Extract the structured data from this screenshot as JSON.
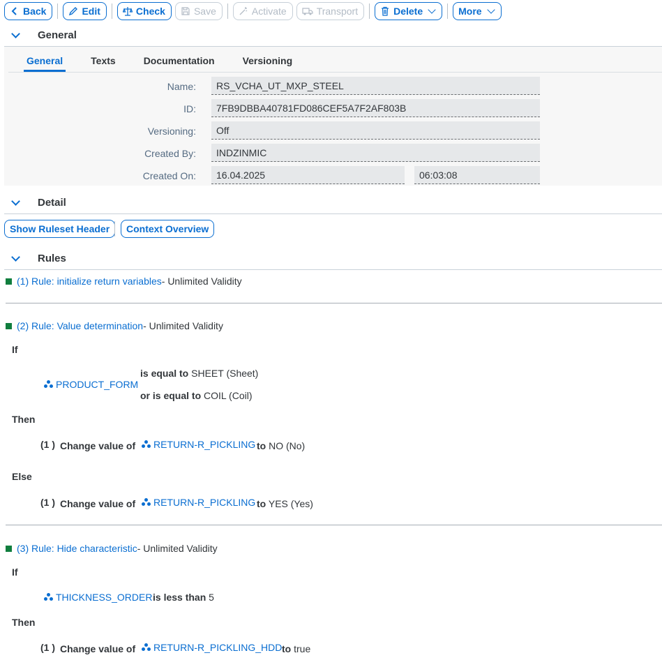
{
  "toolbar": {
    "back": "Back",
    "edit": "Edit",
    "check": "Check",
    "save": "Save",
    "activate": "Activate",
    "transport": "Transport",
    "delete": "Delete",
    "more": "More"
  },
  "general": {
    "section_title": "General",
    "tabs": [
      "General",
      "Texts",
      "Documentation",
      "Versioning"
    ],
    "fields": {
      "name_label": "Name:",
      "name_value": "RS_VCHA_UT_MXP_STEEL",
      "id_label": "ID:",
      "id_value": "7FB9DBBA40781FD086CEF5A7F2AF803B",
      "versioning_label": "Versioning:",
      "versioning_value": "Off",
      "created_by_label": "Created By:",
      "created_by_value": "INDZINMIC",
      "created_on_label": "Created On:",
      "created_on_date": "16.04.2025",
      "created_on_time": "06:03:08"
    }
  },
  "detail": {
    "section_title": "Detail",
    "show_header_button": "Show Ruleset Header",
    "context_button": "Context Overview"
  },
  "rules": {
    "section_title": "Rules",
    "items": [
      {
        "title": "(1) Rule: initialize return variables",
        "validity": " - Unlimited Validity"
      },
      {
        "title": "(2) Rule: Value determination",
        "validity": " - Unlimited Validity",
        "if": "If",
        "element": "PRODUCT_FORM",
        "cond1_op": "is equal to",
        "cond1_val": "SHEET (Sheet)",
        "cond2_op": "or is equal to",
        "cond2_val": "COIL (Coil)",
        "then": "Then",
        "then_num": "(1 )",
        "then_action": "Change  value of",
        "then_element": "RETURN-R_PICKLING",
        "then_to": "to",
        "then_value": "NO (No)",
        "else": "Else",
        "else_num": "(1 )",
        "else_action": "Change  value of",
        "else_element": "RETURN-R_PICKLING",
        "else_to": "to",
        "else_value": "YES (Yes)"
      },
      {
        "title": "(3) Rule: Hide characteristic",
        "validity": " - Unlimited Validity",
        "if": "If",
        "element": "THICKNESS_ORDER",
        "cond_op": "is less than",
        "cond_val": "5",
        "then": "Then",
        "then_num": "(1 )",
        "then_action": "Change  value of",
        "then_element": "RETURN-R_PICKLING_HDD",
        "then_to": "to",
        "then_value": "true"
      }
    ]
  },
  "icons": {
    "back": "chevron-left-icon",
    "edit": "pencil-icon",
    "check": "scale-icon",
    "save": "floppy-disk-icon",
    "activate": "magic-wand-icon",
    "transport": "truck-icon",
    "delete": "trash-icon",
    "element": "data-element-icon"
  },
  "colors": {
    "accent": "#0a6ed1",
    "rule_status": "#107e3e"
  }
}
